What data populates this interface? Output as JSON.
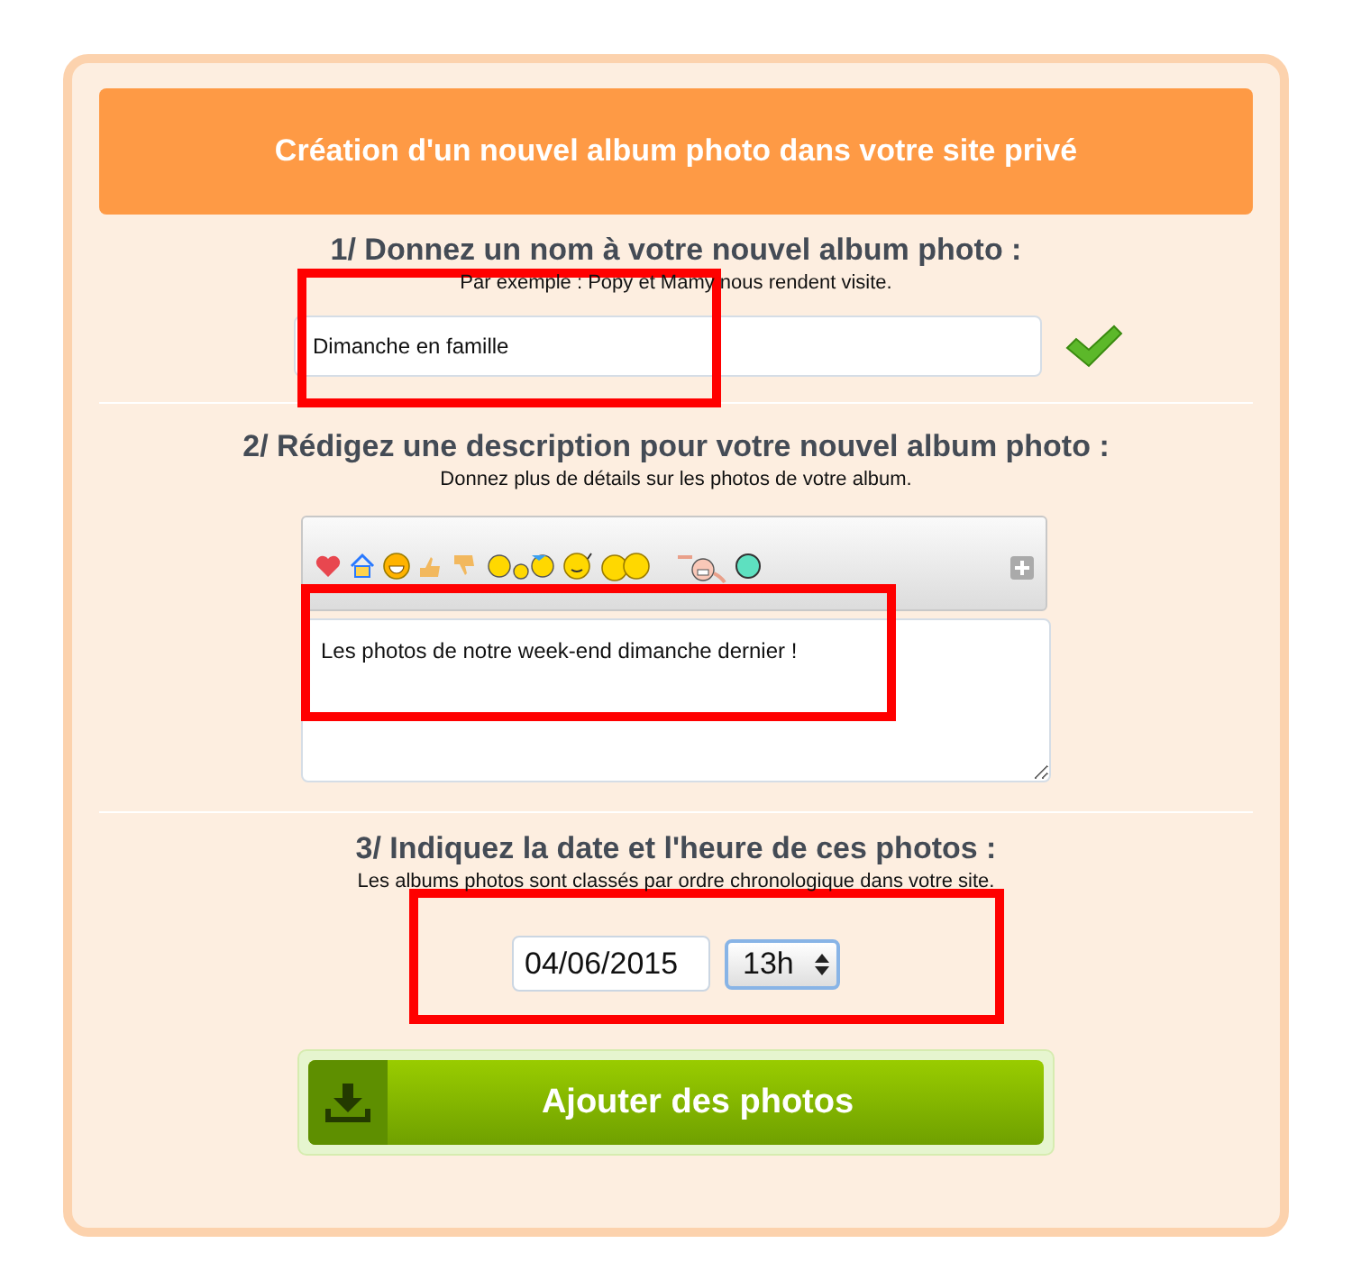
{
  "header": {
    "title": "Création d'un nouvel album photo dans votre site privé"
  },
  "name_section": {
    "title": "1/ Donnez un nom à votre nouvel album photo :",
    "hint": "Par exemple : Popy et Mamy nous rendent visite.",
    "value": "Dimanche en famille",
    "valid": true,
    "highlighted": true
  },
  "description_section": {
    "title": "2/ Rédigez une description pour votre nouvel album photo :",
    "hint": "Donnez plus de détails sur les photos de votre album.",
    "value": "Les photos de notre week-end dimanche dernier !",
    "highlighted": true
  },
  "date_section": {
    "title": "3/ Indiquez la date et l'heure de ces photos :",
    "hint": "Les albums photos sont classés par ordre chronologique dans votre site.",
    "date": "04/06/2015",
    "hour": "13h",
    "highlighted": true
  },
  "submit_button": {
    "label": "Ajouter des photos"
  }
}
